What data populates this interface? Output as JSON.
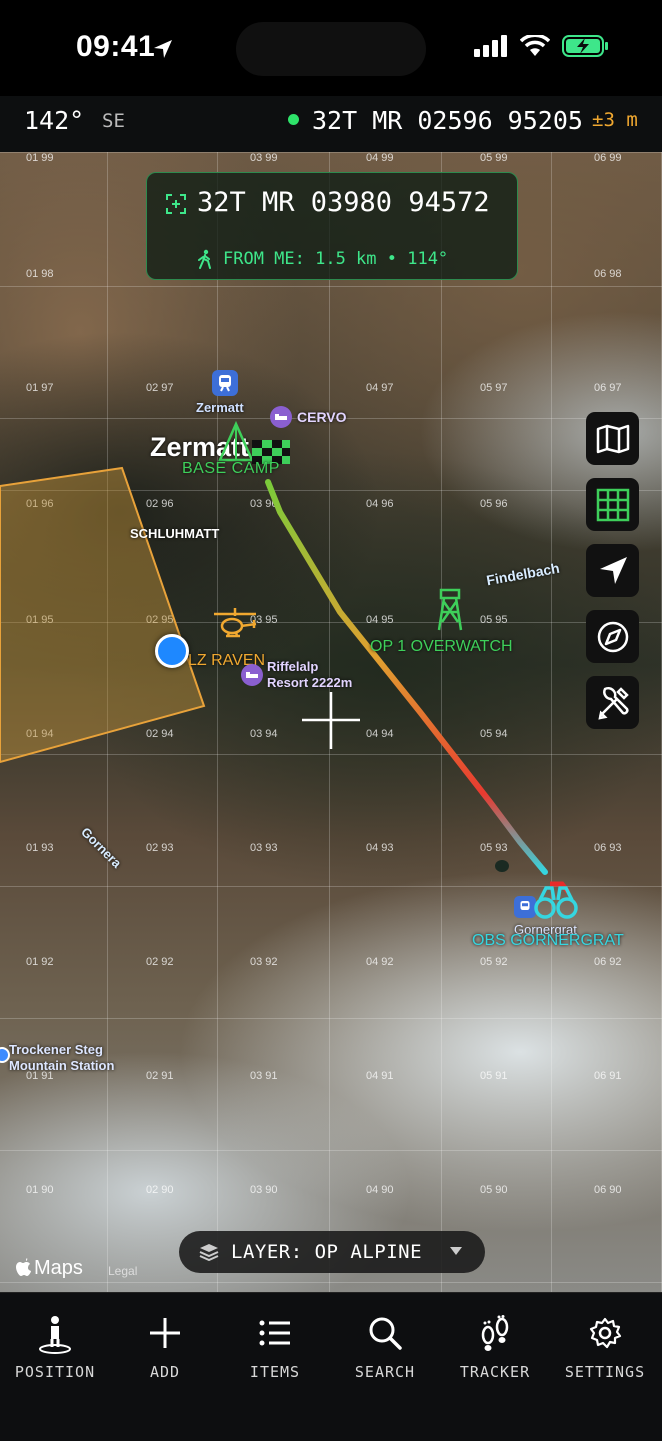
{
  "status_bar": {
    "time": "09:41"
  },
  "header": {
    "heading": "142°",
    "direction": "SE",
    "gps_coord": "32T MR 02596 95205",
    "accuracy": "±3 m"
  },
  "target_box": {
    "coord": "32T MR 03980 94572",
    "from_me": "FROM ME: 1.5 km • 114°"
  },
  "map": {
    "labels": {
      "zermatt_station": "Zermatt",
      "cervo": "CERVO",
      "zermatt_town": "Zermatt",
      "base_camp": "BASE CAMP",
      "schluhmatt": "SCHLUHMATT",
      "findelbach": "Findelbach",
      "op1": "OP 1 OVERWATCH",
      "lz_raven": "LZ RAVEN",
      "riffelalp_1": "Riffelalp",
      "riffelalp_2": "Resort 2222m",
      "gornera": "Gornera",
      "gornergrat": "Gornergrat",
      "obs": "OBS GORNERGRAT",
      "trockener_1": "Trockener Steg",
      "trockener_2": "Mountain Station"
    },
    "grid_labels": [
      "01 99",
      "03 99",
      "04 99",
      "05 99",
      "06 99",
      "01 98",
      "06 98",
      "01 97",
      "02 97",
      "04 97",
      "05 97",
      "06 97",
      "01 96",
      "02 96",
      "03 96",
      "04 96",
      "05 96",
      "01 95",
      "02 95",
      "03 95",
      "04 95",
      "05 95",
      "01 94",
      "02 94",
      "03 94",
      "04 94",
      "05 94",
      "01 93",
      "02 93",
      "03 93",
      "04 93",
      "05 93",
      "06 93",
      "01 92",
      "02 92",
      "03 92",
      "04 92",
      "05 92",
      "06 92",
      "01 91",
      "02 91",
      "03 91",
      "04 91",
      "05 91",
      "06 91",
      "01 90",
      "02 90",
      "03 90",
      "04 90",
      "05 90",
      "06 90"
    ],
    "layer_label": "LAYER: OP ALPINE",
    "attribution": "Maps",
    "legal": "Legal"
  },
  "map_controls": [
    "map-icon",
    "grid-icon",
    "location-arrow-icon",
    "compass-icon",
    "tools-icon"
  ],
  "tabs": [
    {
      "label": "POSITION",
      "icon": "position-icon"
    },
    {
      "label": "ADD",
      "icon": "plus-icon"
    },
    {
      "label": "ITEMS",
      "icon": "list-icon"
    },
    {
      "label": "SEARCH",
      "icon": "search-icon"
    },
    {
      "label": "TRACKER",
      "icon": "footprints-icon"
    },
    {
      "label": "SETTINGS",
      "icon": "gear-icon"
    }
  ],
  "colors": {
    "accent_green": "#3ee68a",
    "warning_orange": "#f0a830",
    "zone_orange": "#e8a23a",
    "obs_cyan": "#35d6e0",
    "location_blue": "#1e88ff"
  }
}
